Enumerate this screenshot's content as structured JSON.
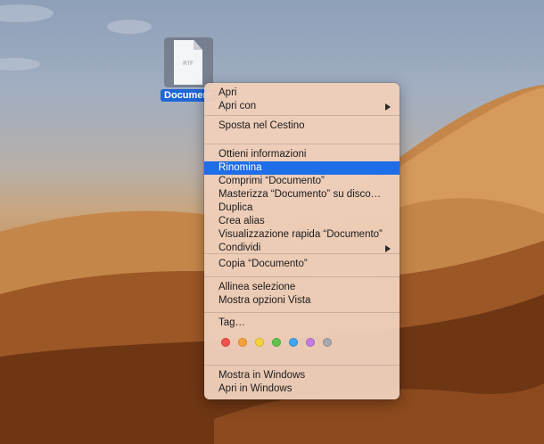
{
  "desktop_file": {
    "name": "Documento",
    "visible_label": "Document",
    "type_label": "RTF"
  },
  "context_menu": {
    "groups": [
      [
        {
          "label": "Apri"
        },
        {
          "label": "Apri con",
          "submenu": true
        }
      ],
      [
        {
          "label": "Sposta nel Cestino"
        }
      ],
      [
        {
          "label": "Ottieni informazioni"
        },
        {
          "label": "Rinomina",
          "highlighted": true
        },
        {
          "label": "Comprimi “Documento”"
        },
        {
          "label": "Masterizza “Documento” su disco…"
        },
        {
          "label": "Duplica"
        },
        {
          "label": "Crea alias"
        },
        {
          "label": "Visualizzazione rapida “Documento”"
        },
        {
          "label": "Condividi",
          "submenu": true
        }
      ],
      [
        {
          "label": "Copia “Documento”"
        }
      ],
      [
        {
          "label": "Allinea selezione"
        },
        {
          "label": "Mostra opzioni Vista"
        }
      ],
      [
        {
          "label": "Tag…"
        }
      ],
      [
        {
          "label": "Mostra in Windows"
        },
        {
          "label": "Apri in Windows"
        }
      ]
    ],
    "tag_colors": [
      {
        "name": "red",
        "color": "#f4524c"
      },
      {
        "name": "orange",
        "color": "#f6a03a"
      },
      {
        "name": "yellow",
        "color": "#f6d33a"
      },
      {
        "name": "green",
        "color": "#5fc54a"
      },
      {
        "name": "blue",
        "color": "#3ea5f4"
      },
      {
        "name": "purple",
        "color": "#c57be0"
      },
      {
        "name": "gray",
        "color": "#a8a8ad"
      }
    ]
  },
  "colors": {
    "highlight": "#1e6ee8",
    "selection_label": "#1f66d6"
  }
}
